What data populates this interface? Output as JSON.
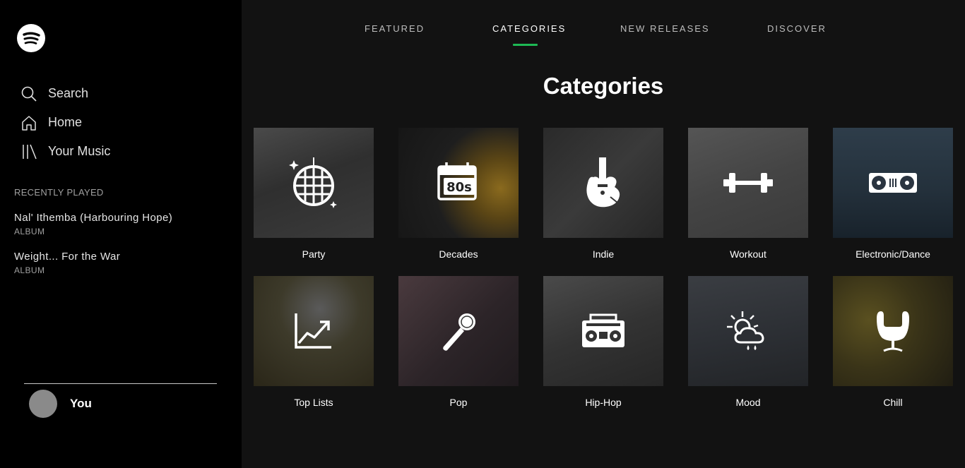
{
  "sidebar": {
    "logo_icon": "spotify-logo",
    "nav": [
      {
        "label": "Search",
        "icon": "search-icon"
      },
      {
        "label": "Home",
        "icon": "home-icon"
      },
      {
        "label": "Your Music",
        "icon": "library-icon"
      }
    ],
    "recently_played_title": "RECENTLY PLAYED",
    "recently_played": [
      {
        "name": "Nal' Ithemba (Harbouring Hope)",
        "type": "ALBUM"
      },
      {
        "name": "Weight... For the War",
        "type": "ALBUM"
      }
    ],
    "user": {
      "name": "You"
    }
  },
  "tabs": [
    {
      "label": "FEATURED",
      "active": false
    },
    {
      "label": "CATEGORIES",
      "active": true
    },
    {
      "label": "NEW RELEASES",
      "active": false
    },
    {
      "label": "DISCOVER",
      "active": false
    }
  ],
  "page_title": "Categories",
  "categories": [
    {
      "label": "Party",
      "icon": "disco-ball-icon"
    },
    {
      "label": "Decades",
      "icon": "calendar-80s-icon"
    },
    {
      "label": "Indie",
      "icon": "guitar-icon"
    },
    {
      "label": "Workout",
      "icon": "dumbbell-icon"
    },
    {
      "label": "Electronic/Dance",
      "icon": "turntable-icon"
    },
    {
      "label": "Top Lists",
      "icon": "trend-chart-icon"
    },
    {
      "label": "Pop",
      "icon": "microphone-icon"
    },
    {
      "label": "Hip-Hop",
      "icon": "boombox-icon"
    },
    {
      "label": "Mood",
      "icon": "weather-icon"
    },
    {
      "label": "Chill",
      "icon": "egg-chair-icon"
    }
  ],
  "colors": {
    "accent": "#1db954",
    "sidebar_bg": "#000000",
    "main_bg": "#121212"
  }
}
